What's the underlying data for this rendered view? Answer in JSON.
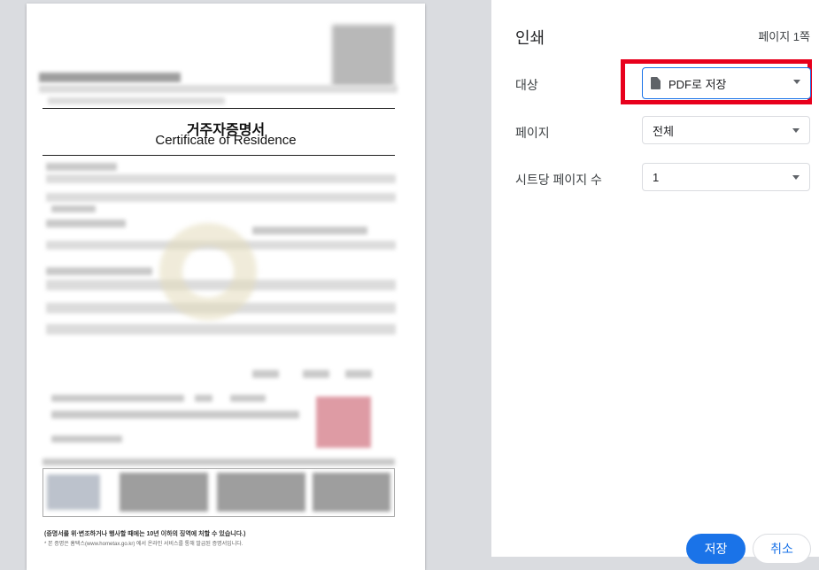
{
  "preview": {
    "document": {
      "title_ko": "거주자증명서",
      "title_en": "Certificate of Residence",
      "footnote_warning": "(증명서를 위·변조하거나 행사할 때에는 10년 이하의 징역에 처할 수 있습니다.)",
      "footnote_info": "* 본 증명은 홈택스(www.hometax.go.kr) 에서 온라인 서비스를 통해 발급된 증명서입니다."
    }
  },
  "panel": {
    "title": "인쇄",
    "page_count": "페이지 1쪽",
    "destination": {
      "label": "대상",
      "value": "PDF로 저장",
      "icon": "file-icon"
    },
    "pages": {
      "label": "페이지",
      "value": "전체"
    },
    "pages_per_sheet": {
      "label": "시트당 페이지 수",
      "value": "1"
    },
    "save_label": "저장",
    "cancel_label": "취소"
  },
  "colors": {
    "accent": "#1a73e8",
    "highlight": "#e8001c"
  }
}
